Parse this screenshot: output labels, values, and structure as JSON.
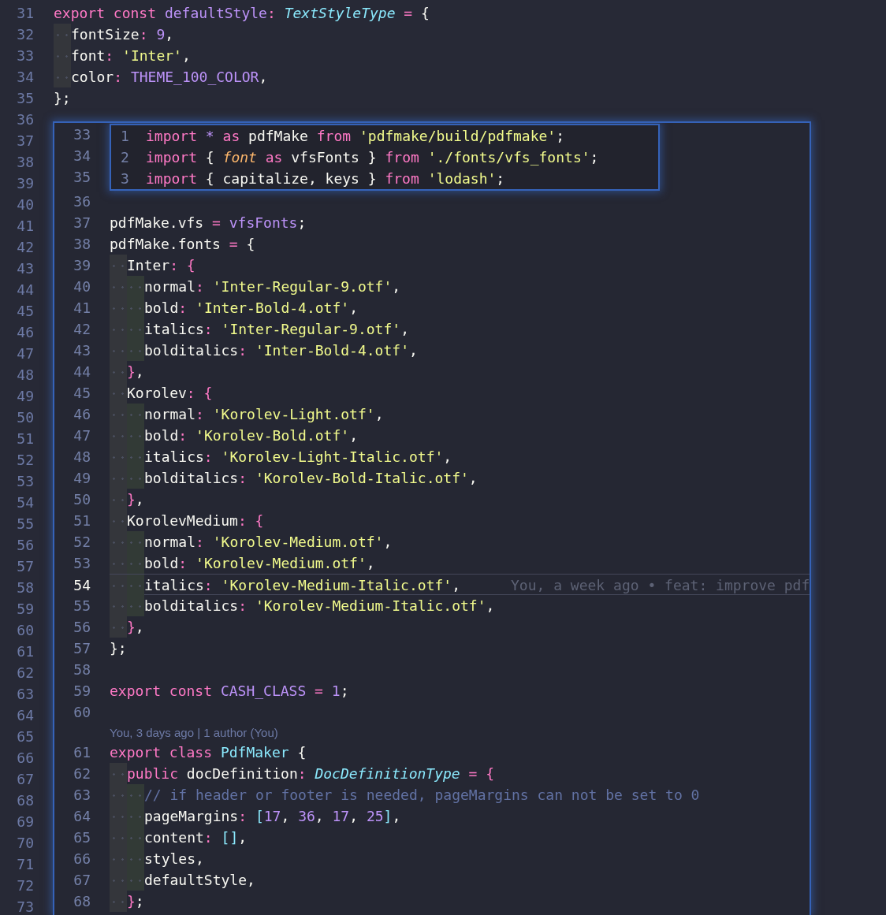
{
  "editor": {
    "gutter": [
      "31",
      "32",
      "33",
      "34",
      "35",
      "36",
      "37",
      "38",
      "39",
      "40",
      "41",
      "42",
      "43",
      "44",
      "45",
      "46",
      "47",
      "48",
      "49",
      "50",
      "51",
      "52",
      "53",
      "54",
      "55",
      "56",
      "57",
      "58",
      "59",
      "60",
      "61",
      "62",
      "63",
      "64",
      "65",
      "66",
      "67",
      "68",
      "69",
      "70",
      "71",
      "72",
      "73"
    ],
    "lines": [
      {
        "tokens": [
          {
            "kind": "kw",
            "text": "export "
          },
          {
            "kind": "kw",
            "text": "const "
          },
          {
            "kind": "var",
            "text": "defaultStyle"
          },
          {
            "kind": "op",
            "text": ": "
          },
          {
            "kind": "type",
            "text": "TextStyleType"
          },
          {
            "kind": "op",
            "text": " = "
          },
          {
            "kind": "plain",
            "text": "{"
          }
        ],
        "children": [
          {
            "tokens": [
              {
                "kind": "plain",
                "text": "fontSize"
              },
              {
                "kind": "op",
                "text": ": "
              },
              {
                "kind": "num",
                "text": "9"
              },
              {
                "kind": "plain",
                "text": ","
              }
            ]
          },
          {
            "tokens": [
              {
                "kind": "plain",
                "text": "font"
              },
              {
                "kind": "op",
                "text": ": "
              },
              {
                "kind": "str",
                "text": "'Inter'"
              },
              {
                "kind": "plain",
                "text": ","
              }
            ]
          },
          {
            "tokens": [
              {
                "kind": "plain",
                "text": "color"
              },
              {
                "kind": "op",
                "text": ": "
              },
              {
                "kind": "var",
                "text": "THEME_100_COLOR"
              },
              {
                "kind": "plain",
                "text": ","
              }
            ]
          }
        ]
      },
      {
        "tokens": [
          {
            "kind": "plain",
            "text": "};"
          }
        ]
      }
    ]
  },
  "peek": {
    "covered_numbers": [
      "33",
      "34",
      "35"
    ],
    "hover": [
      {
        "number": "1",
        "tokens": [
          {
            "kind": "kw",
            "text": "import "
          },
          {
            "kind": "var",
            "text": "* "
          },
          {
            "kind": "kw",
            "text": "as "
          },
          {
            "kind": "plain",
            "text": "pdfMake "
          },
          {
            "kind": "kw",
            "text": "from "
          },
          {
            "kind": "str",
            "text": "'pdfmake/build/pdfmake'"
          },
          {
            "kind": "plain",
            "text": ";"
          }
        ]
      },
      {
        "number": "2",
        "tokens": [
          {
            "kind": "kw",
            "text": "import "
          },
          {
            "kind": "plain",
            "text": "{ "
          },
          {
            "kind": "param",
            "text": "font "
          },
          {
            "kind": "kw",
            "text": "as "
          },
          {
            "kind": "plain",
            "text": "vfsFonts } "
          },
          {
            "kind": "kw",
            "text": "from "
          },
          {
            "kind": "str",
            "text": "'./fonts/vfs_fonts'"
          },
          {
            "kind": "plain",
            "text": ";"
          }
        ]
      },
      {
        "number": "3",
        "tokens": [
          {
            "kind": "kw",
            "text": "import "
          },
          {
            "kind": "plain",
            "text": "{ capitalize, keys } "
          },
          {
            "kind": "kw",
            "text": "from "
          },
          {
            "kind": "str",
            "text": "'lodash'"
          },
          {
            "kind": "plain",
            "text": ";"
          }
        ]
      }
    ],
    "lines": [
      {
        "kind": "code",
        "number": "36",
        "current": false
      },
      {
        "kind": "code",
        "number": "37",
        "current": false,
        "tokens": [
          {
            "kind": "plain",
            "text": "pdfMake.vfs "
          },
          {
            "kind": "op",
            "text": "= "
          },
          {
            "kind": "var",
            "text": "vfsFonts"
          },
          {
            "kind": "plain",
            "text": ";"
          }
        ]
      },
      {
        "kind": "code",
        "number": "38",
        "current": false,
        "tokens": [
          {
            "kind": "plain",
            "text": "pdfMake.fonts "
          },
          {
            "kind": "op",
            "text": "= "
          },
          {
            "kind": "plain",
            "text": "{"
          }
        ],
        "children": [
          {
            "kind": "code",
            "number": "39",
            "current": false,
            "tokens": [
              {
                "kind": "plain",
                "text": "Inter"
              },
              {
                "kind": "op",
                "text": ": {"
              }
            ],
            "children": [
              {
                "kind": "code",
                "number": "40",
                "current": false,
                "tokens": [
                  {
                    "kind": "plain",
                    "text": "normal"
                  },
                  {
                    "kind": "op",
                    "text": ": "
                  },
                  {
                    "kind": "str",
                    "text": "'Inter-Regular-9.otf'"
                  },
                  {
                    "kind": "plain",
                    "text": ","
                  }
                ]
              },
              {
                "kind": "code",
                "number": "41",
                "current": false,
                "tokens": [
                  {
                    "kind": "plain",
                    "text": "bold"
                  },
                  {
                    "kind": "op",
                    "text": ": "
                  },
                  {
                    "kind": "str",
                    "text": "'Inter-Bold-4.otf'"
                  },
                  {
                    "kind": "plain",
                    "text": ","
                  }
                ]
              },
              {
                "kind": "code",
                "number": "42",
                "current": false,
                "tokens": [
                  {
                    "kind": "plain",
                    "text": "italics"
                  },
                  {
                    "kind": "op",
                    "text": ": "
                  },
                  {
                    "kind": "str",
                    "text": "'Inter-Regular-9.otf'"
                  },
                  {
                    "kind": "plain",
                    "text": ","
                  }
                ]
              },
              {
                "kind": "code",
                "number": "43",
                "current": false,
                "tokens": [
                  {
                    "kind": "plain",
                    "text": "bolditalics"
                  },
                  {
                    "kind": "op",
                    "text": ": "
                  },
                  {
                    "kind": "str",
                    "text": "'Inter-Bold-4.otf'"
                  },
                  {
                    "kind": "plain",
                    "text": ","
                  }
                ]
              }
            ]
          },
          {
            "kind": "code",
            "number": "44",
            "current": false,
            "tokens": [
              {
                "kind": "op",
                "text": "}"
              },
              {
                "kind": "plain",
                "text": ","
              }
            ]
          },
          {
            "kind": "code",
            "number": "45",
            "current": false,
            "tokens": [
              {
                "kind": "plain",
                "text": "Korolev"
              },
              {
                "kind": "op",
                "text": ": {"
              }
            ],
            "children": [
              {
                "kind": "code",
                "number": "46",
                "current": false,
                "tokens": [
                  {
                    "kind": "plain",
                    "text": "normal"
                  },
                  {
                    "kind": "op",
                    "text": ": "
                  },
                  {
                    "kind": "str",
                    "text": "'Korolev-Light.otf'"
                  },
                  {
                    "kind": "plain",
                    "text": ","
                  }
                ]
              },
              {
                "kind": "code",
                "number": "47",
                "current": false,
                "tokens": [
                  {
                    "kind": "plain",
                    "text": "bold"
                  },
                  {
                    "kind": "op",
                    "text": ": "
                  },
                  {
                    "kind": "str",
                    "text": "'Korolev-Bold.otf'"
                  },
                  {
                    "kind": "plain",
                    "text": ","
                  }
                ]
              },
              {
                "kind": "code",
                "number": "48",
                "current": false,
                "tokens": [
                  {
                    "kind": "plain",
                    "text": "italics"
                  },
                  {
                    "kind": "op",
                    "text": ": "
                  },
                  {
                    "kind": "str",
                    "text": "'Korolev-Light-Italic.otf'"
                  },
                  {
                    "kind": "plain",
                    "text": ","
                  }
                ]
              },
              {
                "kind": "code",
                "number": "49",
                "current": false,
                "tokens": [
                  {
                    "kind": "plain",
                    "text": "bolditalics"
                  },
                  {
                    "kind": "op",
                    "text": ": "
                  },
                  {
                    "kind": "str",
                    "text": "'Korolev-Bold-Italic.otf'"
                  },
                  {
                    "kind": "plain",
                    "text": ","
                  }
                ]
              }
            ]
          },
          {
            "kind": "code",
            "number": "50",
            "current": false,
            "tokens": [
              {
                "kind": "op",
                "text": "}"
              },
              {
                "kind": "plain",
                "text": ","
              }
            ]
          },
          {
            "kind": "code",
            "number": "51",
            "current": false,
            "tokens": [
              {
                "kind": "plain",
                "text": "KorolevMedium"
              },
              {
                "kind": "op",
                "text": ": {"
              }
            ],
            "children": [
              {
                "kind": "code",
                "number": "52",
                "current": false,
                "tokens": [
                  {
                    "kind": "plain",
                    "text": "normal"
                  },
                  {
                    "kind": "op",
                    "text": ": "
                  },
                  {
                    "kind": "str",
                    "text": "'Korolev-Medium.otf'"
                  },
                  {
                    "kind": "plain",
                    "text": ","
                  }
                ]
              },
              {
                "kind": "code",
                "number": "53",
                "current": false,
                "tokens": [
                  {
                    "kind": "plain",
                    "text": "bold"
                  },
                  {
                    "kind": "op",
                    "text": ": "
                  },
                  {
                    "kind": "str",
                    "text": "'Korolev-Medium.otf'"
                  },
                  {
                    "kind": "plain",
                    "text": ","
                  }
                ]
              },
              {
                "kind": "code",
                "number": "54",
                "current": true,
                "blame": "You, a week ago • feat: improve pdf",
                "tokens": [
                  {
                    "kind": "plain",
                    "text": "italics"
                  },
                  {
                    "kind": "op",
                    "text": ": "
                  },
                  {
                    "kind": "str",
                    "text": "'Korolev-Medium-Italic.otf'"
                  },
                  {
                    "kind": "plain",
                    "text": ","
                  }
                ]
              },
              {
                "kind": "code",
                "number": "55",
                "current": false,
                "tokens": [
                  {
                    "kind": "plain",
                    "text": "bolditalics"
                  },
                  {
                    "kind": "op",
                    "text": ": "
                  },
                  {
                    "kind": "str",
                    "text": "'Korolev-Medium-Italic.otf'"
                  },
                  {
                    "kind": "plain",
                    "text": ","
                  }
                ]
              }
            ]
          },
          {
            "kind": "code",
            "number": "56",
            "current": false,
            "tokens": [
              {
                "kind": "op",
                "text": "}"
              },
              {
                "kind": "plain",
                "text": ","
              }
            ]
          }
        ]
      },
      {
        "kind": "code",
        "number": "57",
        "current": false,
        "tokens": [
          {
            "kind": "plain",
            "text": "};"
          }
        ]
      },
      {
        "kind": "code",
        "number": "58",
        "current": false
      },
      {
        "kind": "code",
        "number": "59",
        "current": false,
        "tokens": [
          {
            "kind": "kw",
            "text": "export "
          },
          {
            "kind": "kw",
            "text": "const "
          },
          {
            "kind": "var",
            "text": "CASH_CLASS "
          },
          {
            "kind": "op",
            "text": "= "
          },
          {
            "kind": "num",
            "text": "1"
          },
          {
            "kind": "plain",
            "text": ";"
          }
        ]
      },
      {
        "kind": "code",
        "number": "60",
        "current": false
      },
      {
        "kind": "codelens",
        "text": "You, 3 days ago | 1 author (You)"
      },
      {
        "kind": "code",
        "number": "61",
        "current": false,
        "tokens": [
          {
            "kind": "kw",
            "text": "export "
          },
          {
            "kind": "kw",
            "text": "class "
          },
          {
            "kind": "cls",
            "text": "PdfMaker "
          },
          {
            "kind": "plain",
            "text": "{"
          }
        ],
        "children": [
          {
            "kind": "code",
            "number": "62",
            "current": false,
            "tokens": [
              {
                "kind": "kw",
                "text": "public "
              },
              {
                "kind": "plain",
                "text": "docDefinition"
              },
              {
                "kind": "op",
                "text": ": "
              },
              {
                "kind": "type",
                "text": "DocDefinitionType"
              },
              {
                "kind": "op",
                "text": " = {"
              }
            ],
            "children": [
              {
                "kind": "code",
                "number": "63",
                "current": false,
                "tokens": [
                  {
                    "kind": "comment",
                    "text": "// if header or footer is needed, pageMargins can not be set to 0"
                  }
                ]
              },
              {
                "kind": "code",
                "number": "64",
                "current": false,
                "tokens": [
                  {
                    "kind": "plain",
                    "text": "pageMargins"
                  },
                  {
                    "kind": "op",
                    "text": ": "
                  },
                  {
                    "kind": "cls",
                    "text": "["
                  },
                  {
                    "kind": "num",
                    "text": "17"
                  },
                  {
                    "kind": "plain",
                    "text": ", "
                  },
                  {
                    "kind": "num",
                    "text": "36"
                  },
                  {
                    "kind": "plain",
                    "text": ", "
                  },
                  {
                    "kind": "num",
                    "text": "17"
                  },
                  {
                    "kind": "plain",
                    "text": ", "
                  },
                  {
                    "kind": "num",
                    "text": "25"
                  },
                  {
                    "kind": "cls",
                    "text": "]"
                  },
                  {
                    "kind": "plain",
                    "text": ","
                  }
                ]
              },
              {
                "kind": "code",
                "number": "65",
                "current": false,
                "tokens": [
                  {
                    "kind": "plain",
                    "text": "content"
                  },
                  {
                    "kind": "op",
                    "text": ": "
                  },
                  {
                    "kind": "cls",
                    "text": "[]"
                  },
                  {
                    "kind": "plain",
                    "text": ","
                  }
                ]
              },
              {
                "kind": "code",
                "number": "66",
                "current": false,
                "tokens": [
                  {
                    "kind": "plain",
                    "text": "styles,"
                  }
                ]
              },
              {
                "kind": "code",
                "number": "67",
                "current": false,
                "tokens": [
                  {
                    "kind": "plain",
                    "text": "defaultStyle,"
                  }
                ]
              }
            ]
          },
          {
            "kind": "code",
            "number": "68",
            "current": false,
            "tokens": [
              {
                "kind": "op",
                "text": "}"
              },
              {
                "kind": "plain",
                "text": ";"
              }
            ]
          }
        ]
      }
    ]
  }
}
